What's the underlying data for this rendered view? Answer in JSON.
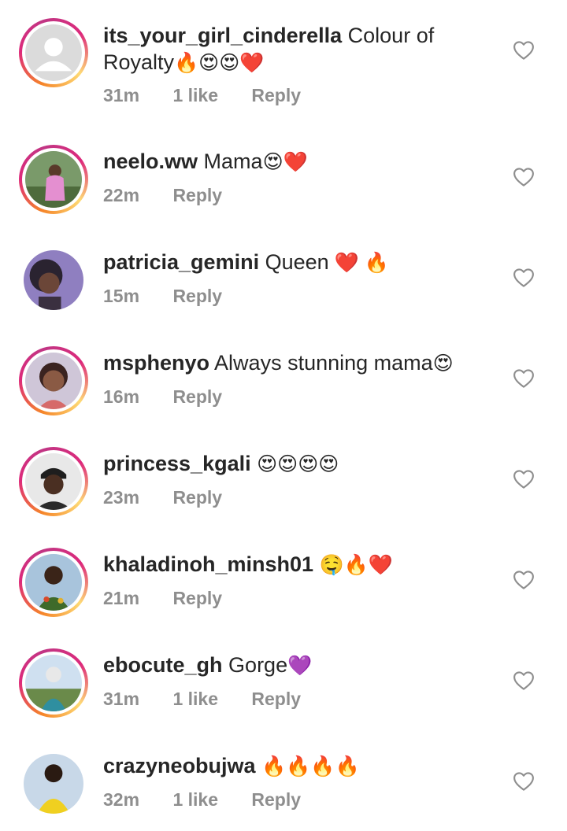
{
  "comments": [
    {
      "username": "its_your_girl_cinderella",
      "text": "Colour of Royalty",
      "emoji": "🔥😍😍❤️",
      "time": "31m",
      "likes": "1 like",
      "reply": "Reply",
      "ring": true
    },
    {
      "username": "neelo.ww",
      "text": "Mama",
      "emoji": "😍❤️",
      "time": "22m",
      "likes": "",
      "reply": "Reply",
      "ring": true
    },
    {
      "username": "patricia_gemini",
      "text": "Queen",
      "emoji": " ❤️ 🔥",
      "time": "15m",
      "likes": "",
      "reply": "Reply",
      "ring": false
    },
    {
      "username": "msphenyo",
      "text": "Always stunning mama",
      "emoji": "😍",
      "time": "16m",
      "likes": "",
      "reply": "Reply",
      "ring": true
    },
    {
      "username": "princess_kgali",
      "text": "",
      "emoji": "😍😍😍😍",
      "time": "23m",
      "likes": "",
      "reply": "Reply",
      "ring": true
    },
    {
      "username": "khaladinoh_minsh01",
      "text": "",
      "emoji": "🤤🔥❤️",
      "time": "21m",
      "likes": "",
      "reply": "Reply",
      "ring": true
    },
    {
      "username": "ebocute_gh",
      "text": "Gorge",
      "emoji": "💜",
      "time": "31m",
      "likes": "1 like",
      "reply": "Reply",
      "ring": true
    },
    {
      "username": "crazyneobujwa",
      "text": "",
      "emoji": "🔥🔥🔥🔥",
      "time": "32m",
      "likes": "1 like",
      "reply": "Reply",
      "ring": false
    }
  ],
  "icons": {
    "like": "heart-outline-icon",
    "avatar_placeholder": "default-avatar-icon"
  }
}
